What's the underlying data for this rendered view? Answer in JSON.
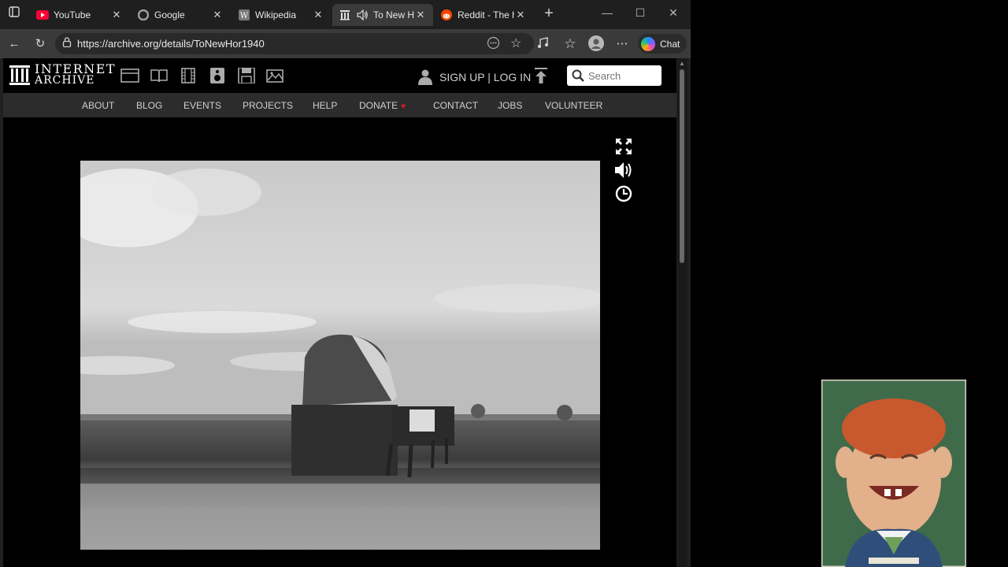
{
  "browser": {
    "tabs": [
      {
        "title": "YouTube",
        "icon": "youtube-icon"
      },
      {
        "title": "Google",
        "icon": "google-icon"
      },
      {
        "title": "Wikipedia",
        "icon": "wikipedia-icon"
      },
      {
        "title": "To New Ho",
        "icon": "archive-icon",
        "active": true
      },
      {
        "title": "Reddit - The he",
        "icon": "reddit-icon"
      }
    ],
    "url": "https://archive.org/details/ToNewHor1940",
    "chat_label": "Chat"
  },
  "archive": {
    "logo_line1": "INTERNET",
    "logo_line2": "ARCHIVE",
    "signup_label": "SIGN UP | LOG IN",
    "search_placeholder": "Search",
    "nav": [
      "ABOUT",
      "BLOG",
      "EVENTS",
      "PROJECTS",
      "HELP",
      "DONATE",
      "CONTACT",
      "JOBS",
      "VOLUNTEER"
    ]
  },
  "colors": {
    "nav_bar": "#2c2c2c",
    "donate_heart": "#e01b24",
    "tab_active": "#3a3a3a"
  }
}
